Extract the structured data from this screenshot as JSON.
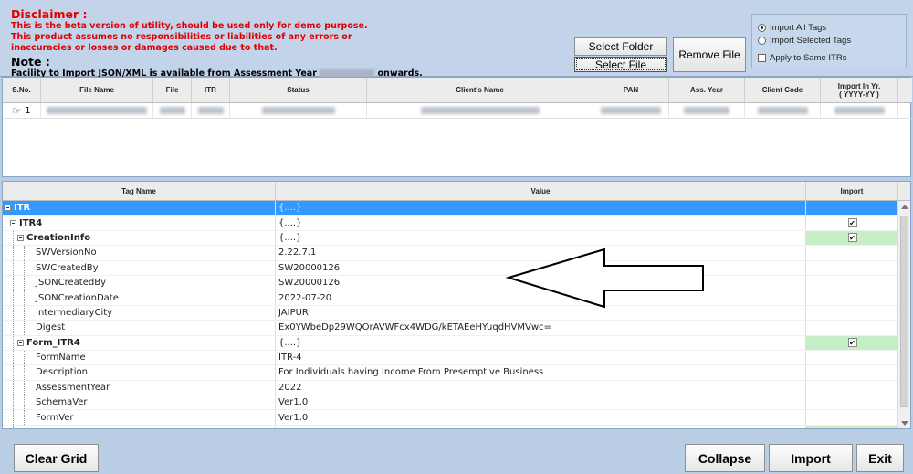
{
  "disclaimer": {
    "title": "Disclaimer :",
    "lines": [
      "This is the beta version of utility, should be used only for demo purpose.",
      "This product assumes no responsibilities or liabilities of any errors or",
      "inaccuracies or losses or damages caused due to that."
    ],
    "note_title": "Note :",
    "note_prefix": "Facility to Import JSON/XML is available from Assessment Year",
    "note_suffix": "onwards."
  },
  "buttons": {
    "select_folder": "Select Folder",
    "select_file": "Select File",
    "remove_file": "Remove File",
    "clear_grid": "Clear Grid",
    "collapse": "Collapse",
    "import": "Import",
    "exit": "Exit"
  },
  "options": {
    "import_all": "Import All Tags",
    "import_selected": "Import Selected Tags",
    "apply_same": "Apply to Same ITRs",
    "selected_option": "import_all"
  },
  "file_grid": {
    "headers": {
      "sno": "S.No.",
      "file_name": "File Name",
      "file": "File",
      "itr": "ITR",
      "status": "Status",
      "client_name": "Client's Name",
      "pan": "PAN",
      "ass_year": "Ass. Year",
      "client_code": "Client Code",
      "import_in_yr": "Import In Yr.",
      "import_in_yr_fmt": "( YYYY-YY )"
    },
    "rows": [
      {
        "sno": "1"
      }
    ]
  },
  "tag_grid": {
    "headers": {
      "tag_name": "Tag Name",
      "value": "Value",
      "import": "Import"
    },
    "rows": [
      {
        "name": "ITR",
        "value": "{....}"
      },
      {
        "name": "ITR4",
        "value": "{....}",
        "import": "✔"
      },
      {
        "name": "CreationInfo",
        "value": "{....}",
        "import": "✔"
      },
      {
        "name": "SWVersionNo",
        "value": "2.22.7.1"
      },
      {
        "name": "SWCreatedBy",
        "value": "SW20000126"
      },
      {
        "name": "JSONCreatedBy",
        "value": "SW20000126"
      },
      {
        "name": "JSONCreationDate",
        "value": "2022-07-20"
      },
      {
        "name": "IntermediaryCity",
        "value": "JAIPUR"
      },
      {
        "name": "Digest",
        "value": "Ex0YWbeDp29WQOrAVWFcx4WDG/kETAEeHYuqdHVMVwc="
      },
      {
        "name": "Form_ITR4",
        "value": "{....}",
        "import": "✔"
      },
      {
        "name": "FormName",
        "value": "ITR-4"
      },
      {
        "name": "Description",
        "value": "For Individuals having Income From Presemptive Business"
      },
      {
        "name": "AssessmentYear",
        "value": "2022"
      },
      {
        "name": "SchemaVer",
        "value": "Ver1.0"
      },
      {
        "name": "FormVer",
        "value": "Ver1.0"
      }
    ]
  }
}
